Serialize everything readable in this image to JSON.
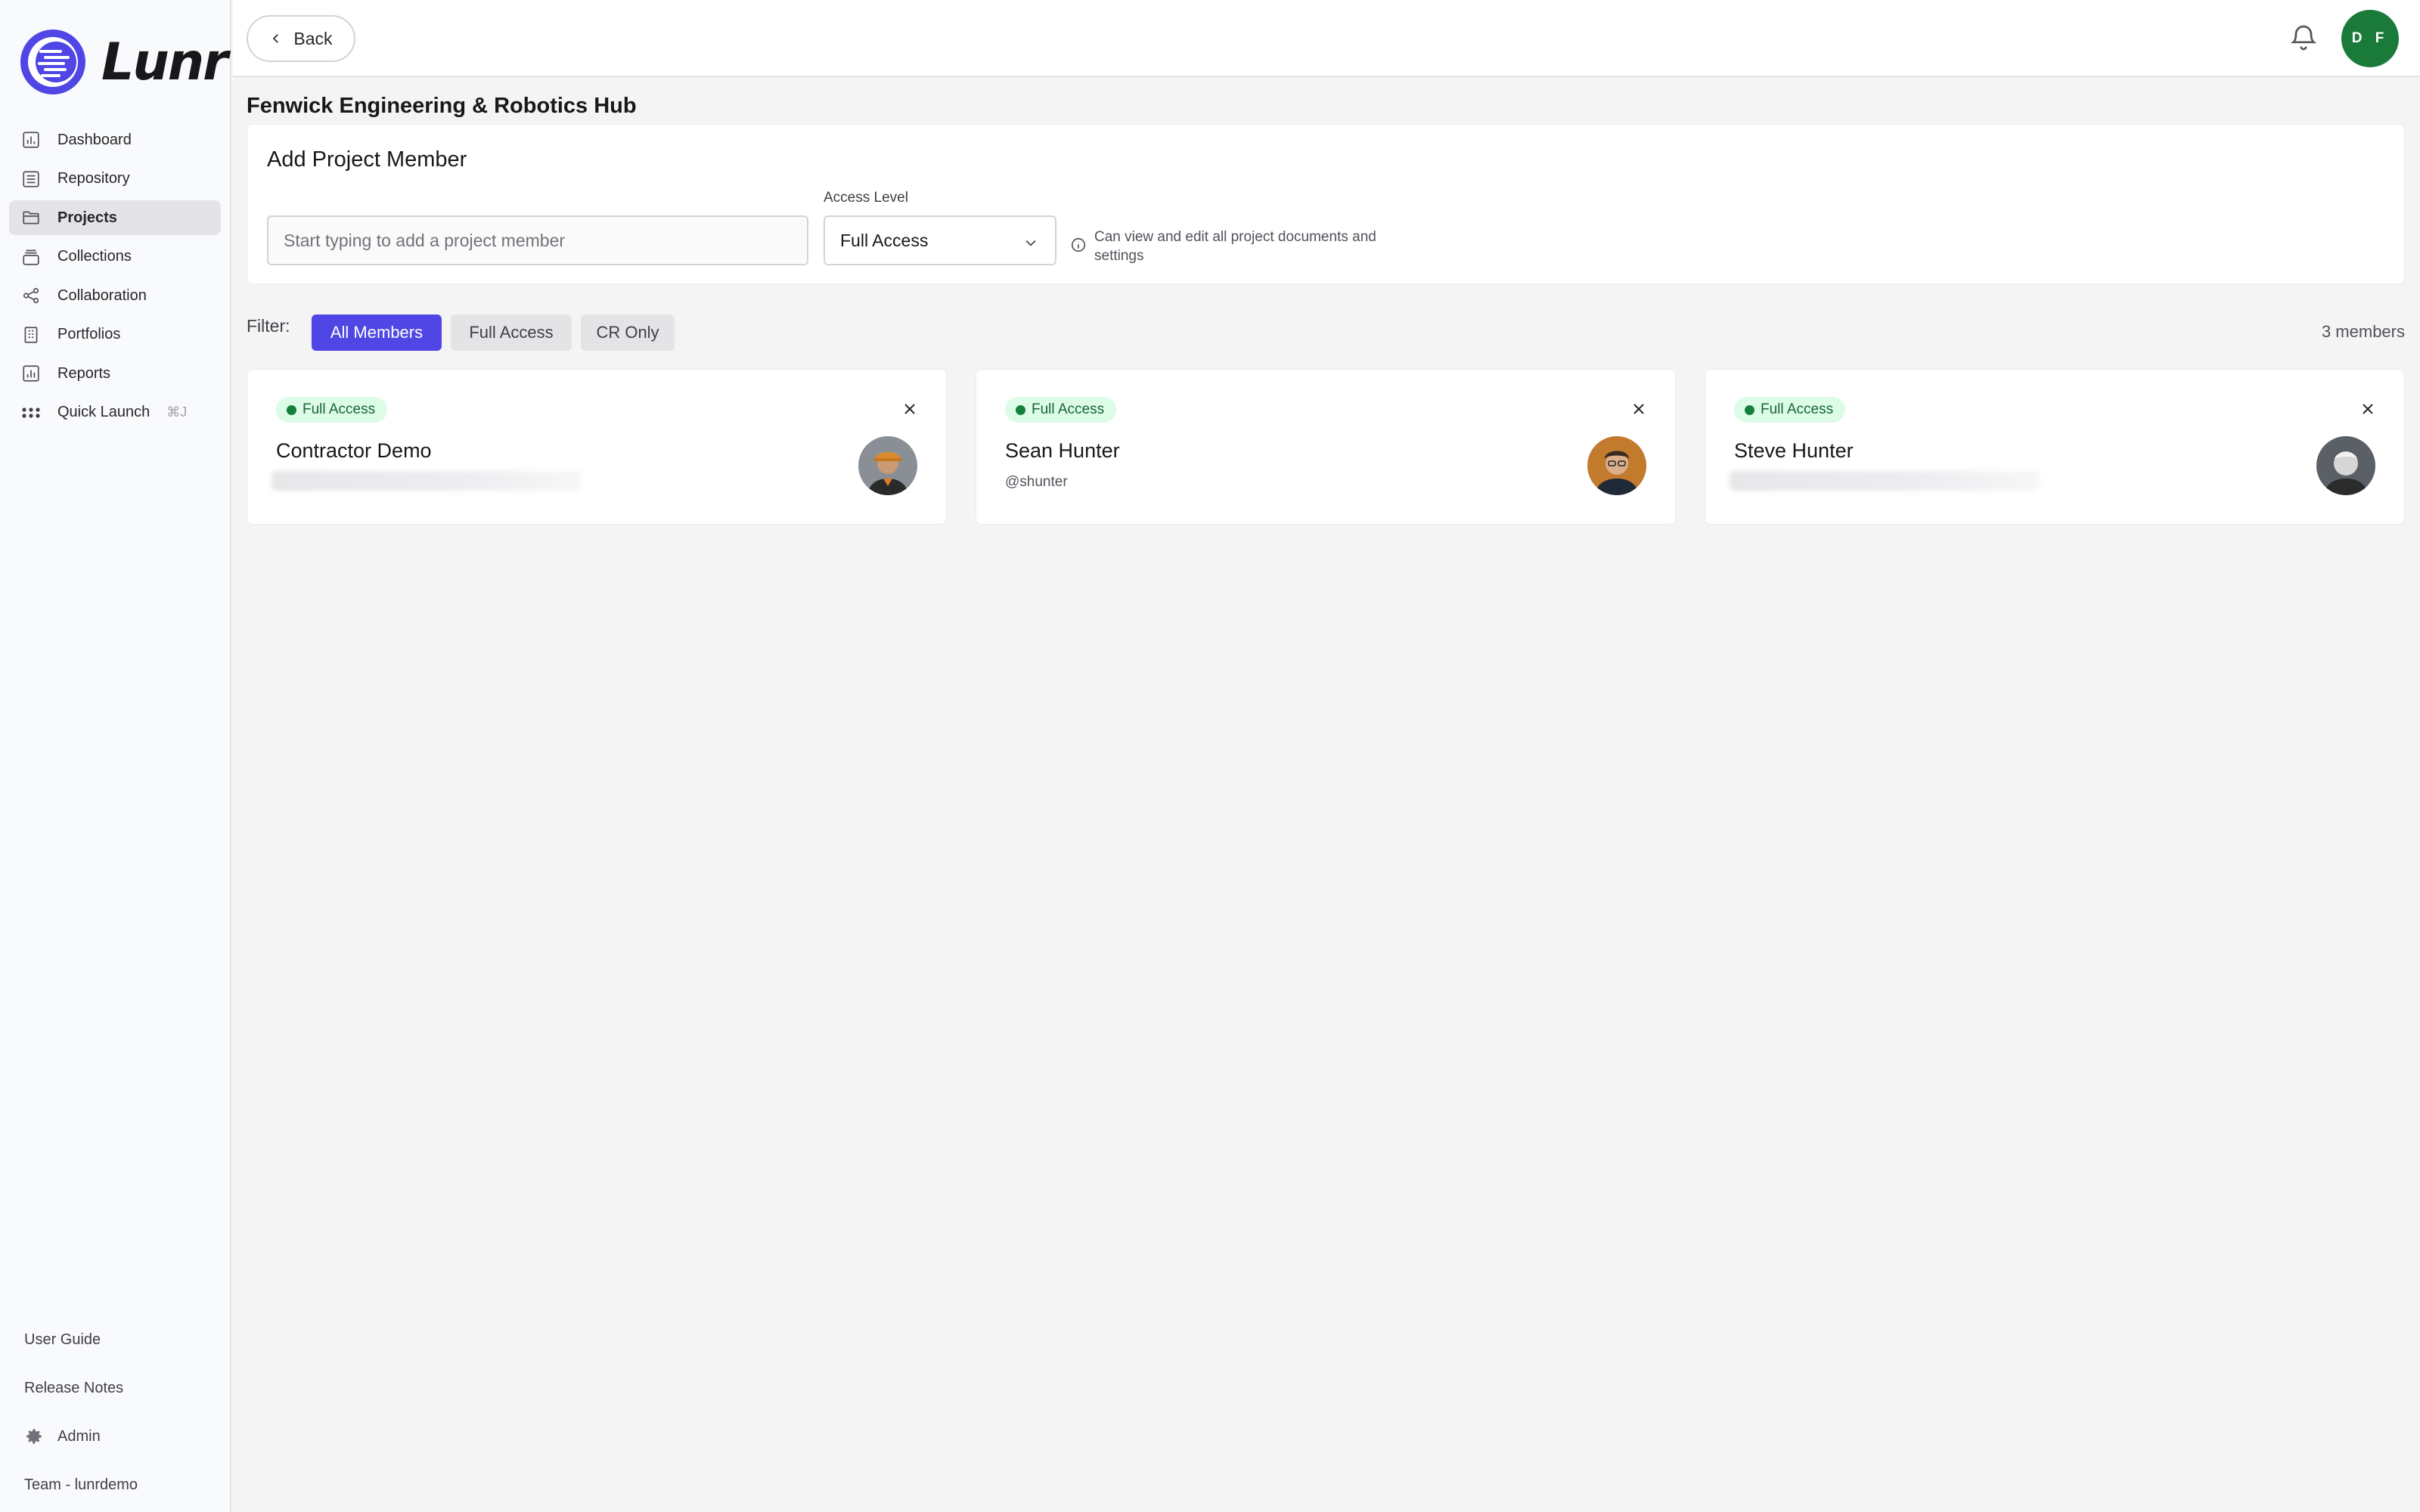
{
  "brand": {
    "name": "Lunr",
    "accent": "#4f46e5"
  },
  "sidebar": {
    "items": [
      {
        "label": "Dashboard",
        "icon": "chart-icon"
      },
      {
        "label": "Repository",
        "icon": "repository-icon"
      },
      {
        "label": "Projects",
        "icon": "folder-icon",
        "active": true
      },
      {
        "label": "Collections",
        "icon": "collection-icon"
      },
      {
        "label": "Collaboration",
        "icon": "share-icon"
      },
      {
        "label": "Portfolios",
        "icon": "building-icon"
      },
      {
        "label": "Reports",
        "icon": "report-icon"
      },
      {
        "label": "Quick Launch",
        "icon": "grid-dots-icon",
        "shortcut": "⌘J"
      }
    ],
    "bottom": {
      "user_guide": "User Guide",
      "release_notes": "Release Notes",
      "admin": "Admin",
      "team": "Team - lunrdemo"
    }
  },
  "topbar": {
    "back_label": "Back",
    "avatar_initials": "D F",
    "avatar_color": "#1a7a3a"
  },
  "page": {
    "title": "Fenwick Engineering & Robotics Hub"
  },
  "add_member": {
    "title": "Add Project Member",
    "input_placeholder": "Start typing to add a project member",
    "access_label": "Access Level",
    "access_value": "Full Access",
    "access_hint": "Can view and edit all project documents and settings"
  },
  "filter": {
    "label": "Filter:",
    "chips": [
      "All Members",
      "Full Access",
      "CR Only"
    ],
    "selected": "All Members",
    "count": "3 members"
  },
  "members": [
    {
      "badge": "Full Access",
      "name": "Contractor Demo",
      "subtitle": "",
      "subtitle_blurred": true
    },
    {
      "badge": "Full Access",
      "name": "Sean Hunter",
      "subtitle": "@shunter",
      "subtitle_blurred": false
    },
    {
      "badge": "Full Access",
      "name": "Steve Hunter",
      "subtitle": "",
      "subtitle_blurred": true
    }
  ]
}
